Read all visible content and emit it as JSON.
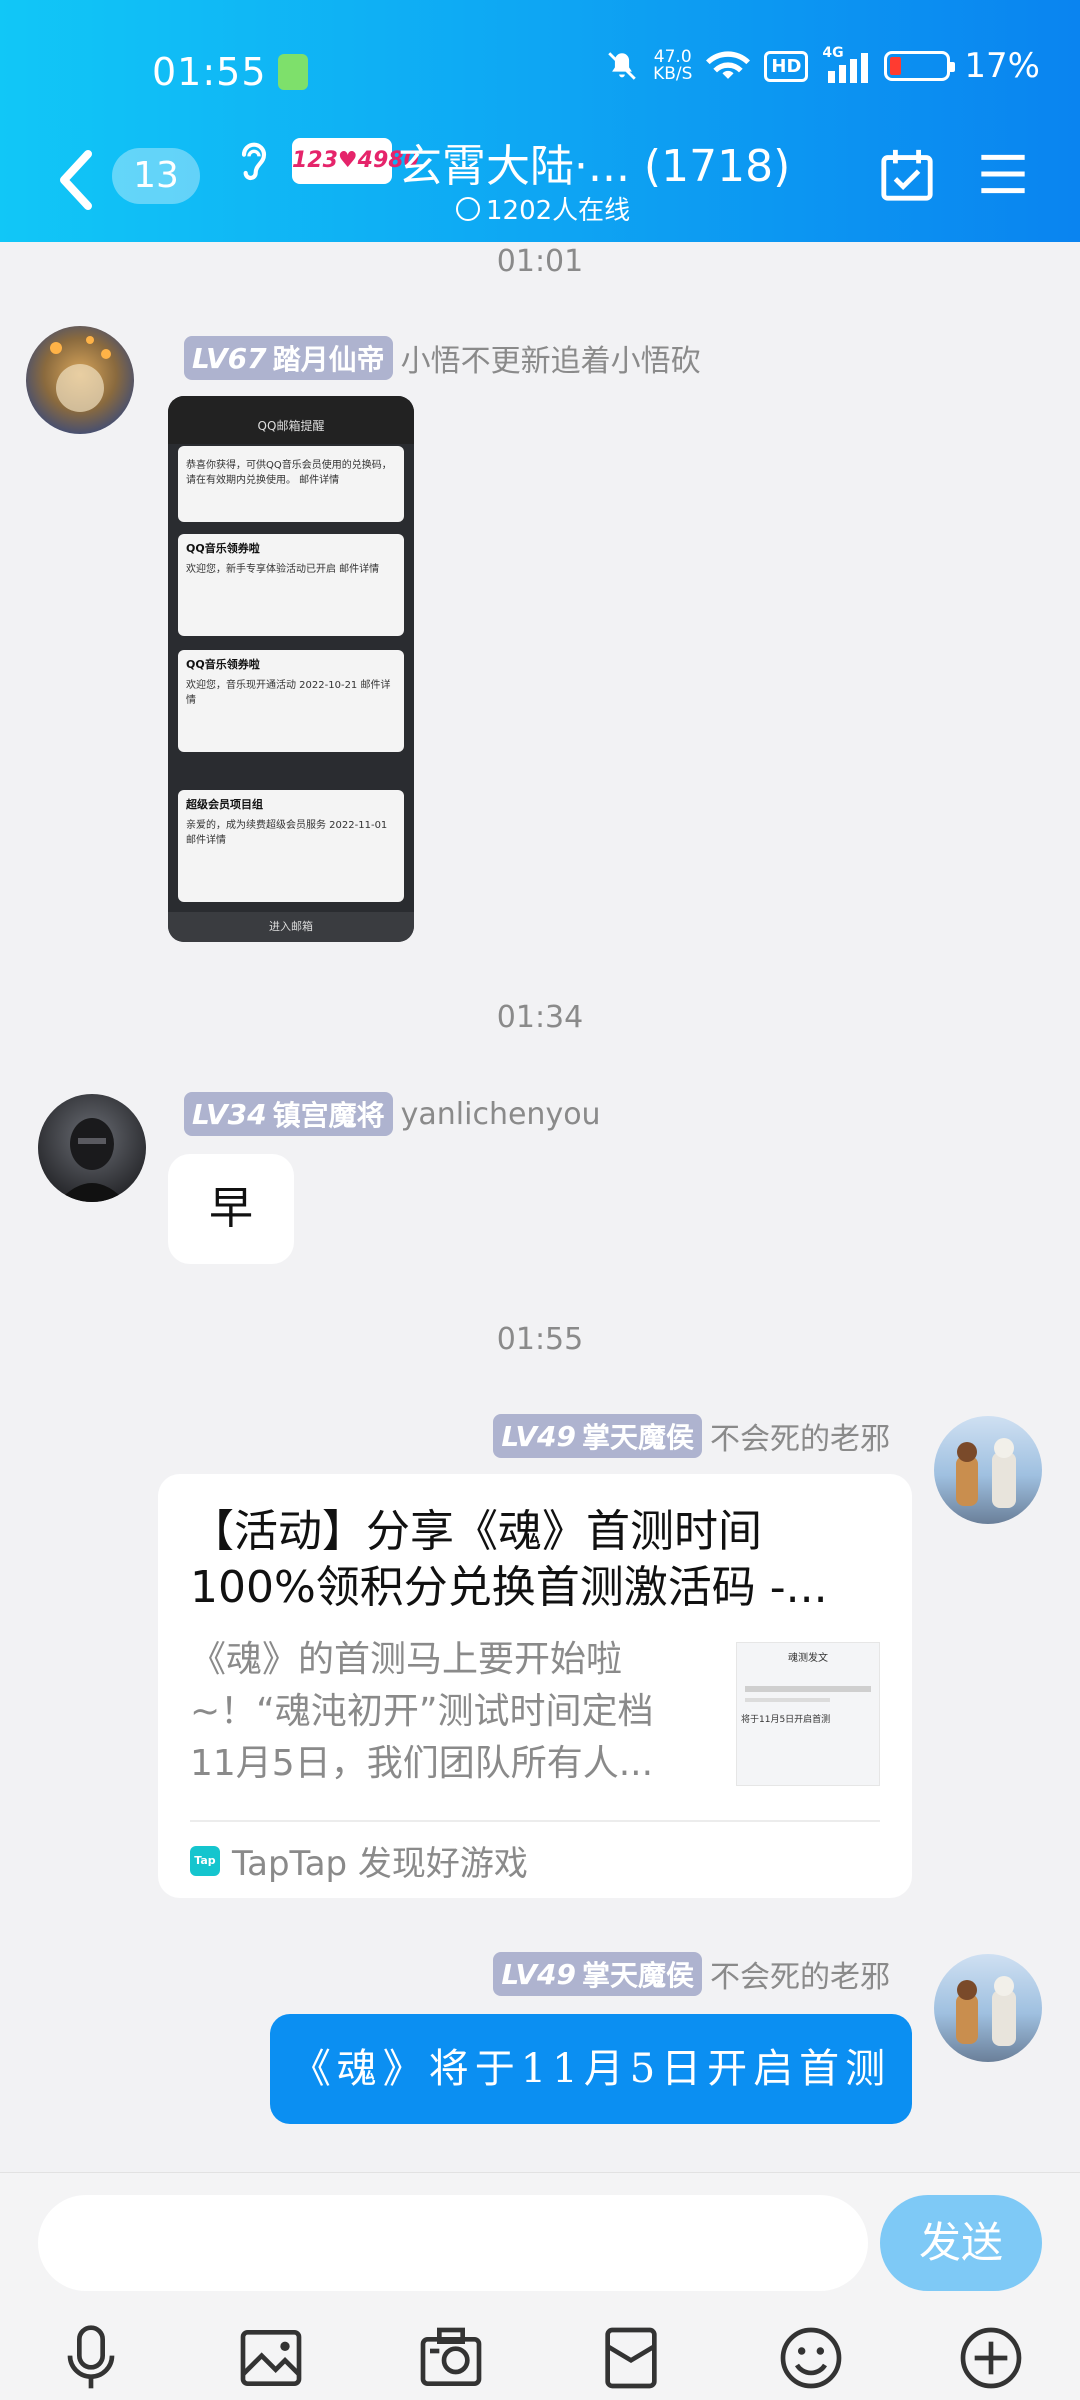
{
  "status": {
    "time": "01:55",
    "net_speed": "47.0",
    "net_unit": "KB/S",
    "hd": "HD",
    "cell": "4G",
    "battery": "17%"
  },
  "header": {
    "unread": "13",
    "logo_text": "123♥4980",
    "title": "玄霄大陆·... (1718)",
    "online": "1202人在线"
  },
  "messages": [
    {
      "stamp": "01:01",
      "level": "LV67",
      "title": "踏月仙帝",
      "name": "小悟不更新追着小悟砍",
      "shot": {
        "top": "QQ邮箱提醒",
        "cards": [
          {
            "title": "",
            "body": "恭喜你获得，可供QQ音乐会员使用的兑换码，请在有效期内兑换使用。 邮件详情"
          },
          {
            "title": "QQ音乐领券啦",
            "body": "欢迎您，新手专享体验活动已开启 邮件详情"
          },
          {
            "title": "QQ音乐领券啦",
            "body": "欢迎您，音乐现开通活动 2022-10-21 邮件详情"
          },
          {
            "title": "超级会员项目组",
            "body": "亲爱的，成为续费超级会员服务 2022-11-01 邮件详情"
          }
        ],
        "foot": "进入邮箱"
      }
    },
    {
      "stamp": "01:34",
      "level": "LV34",
      "title": "镇宫魔将",
      "name": "yanlichenyou",
      "text": "早"
    },
    {
      "stamp": "01:55",
      "level": "LV49",
      "title": "掌天魔侯",
      "name": "不会死的老邪",
      "card": {
        "title": "【活动】分享《魂》首测时间100%领积分兑换首测激活码 -...",
        "desc": "《魂》的首测马上要开始啦~！“魂沌初开”测试时间定档11月5日，我们团队所有人...",
        "thumb_title": "魂测发文",
        "thumb_text": "将于11月5日开启首测",
        "source": "TapTap 发现好游戏",
        "source_logo": "Tap"
      }
    },
    {
      "level": "LV49",
      "title": "掌天魔侯",
      "name": "不会死的老邪",
      "text": "《魂》将于11月5日开启首测"
    }
  ],
  "input": {
    "placeholder": "",
    "send": "发送"
  },
  "colors": {
    "header_start": "#11c7f7",
    "header_end": "#0a84f0",
    "bubble_blue": "#0b8ff2",
    "send_button": "#7ec9f6",
    "badge": "#aeb3cf"
  },
  "toolbar_icons": [
    "microphone-icon",
    "image-icon",
    "camera-icon",
    "red-packet-icon",
    "emoji-icon",
    "plus-icon"
  ]
}
